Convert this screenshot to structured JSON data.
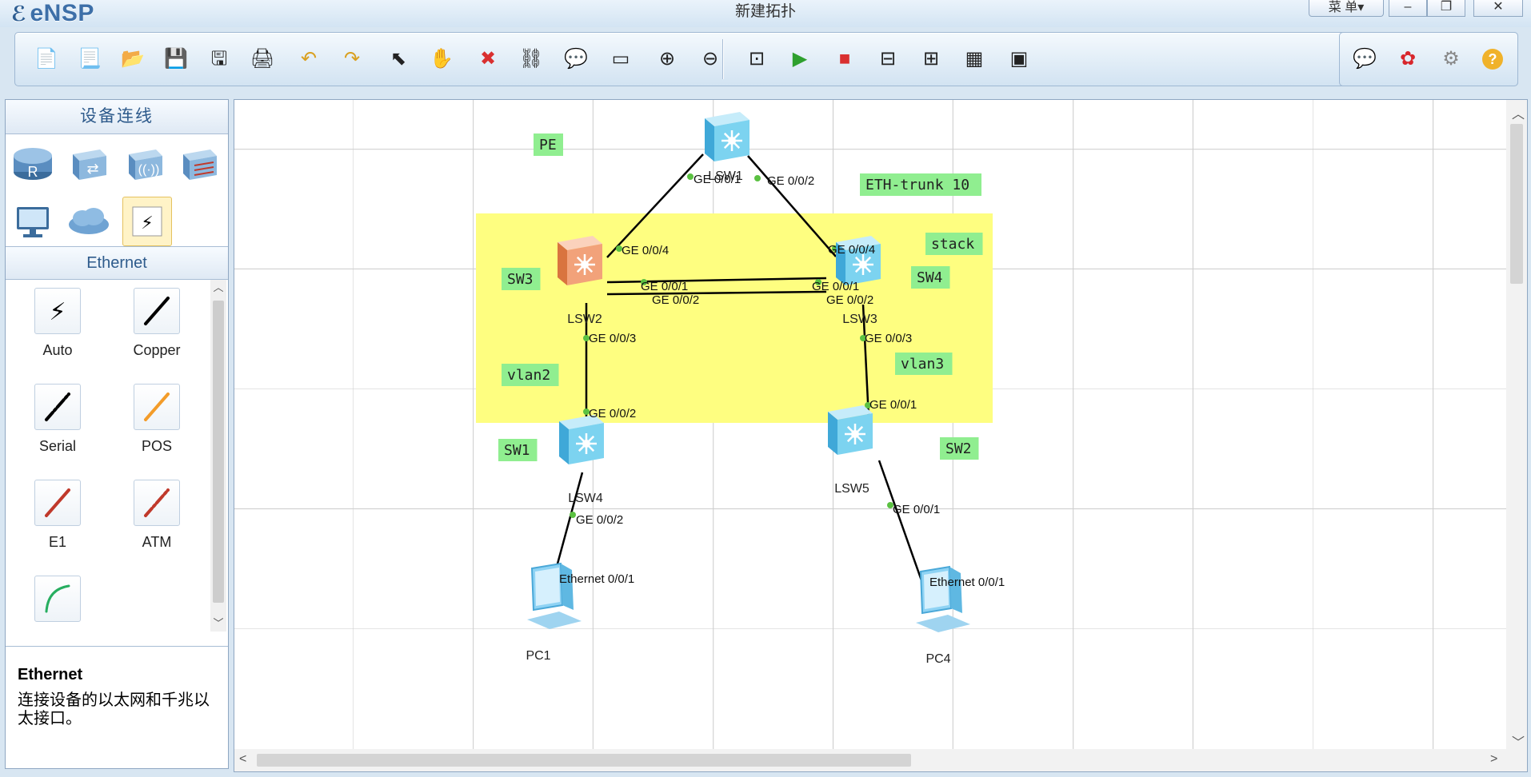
{
  "app": {
    "name": "eNSP",
    "window_title": "新建拓扑",
    "menu_label": "菜 单▾"
  },
  "toolbar": {
    "buttons": [
      {
        "name": "new-topology",
        "icon": "📄"
      },
      {
        "name": "new-example",
        "icon": "📃"
      },
      {
        "name": "open",
        "icon": "📂"
      },
      {
        "name": "save",
        "icon": "💾"
      },
      {
        "name": "save-as",
        "icon": "🖫"
      },
      {
        "name": "print",
        "icon": "🖨"
      },
      {
        "name": "undo",
        "icon": "↶"
      },
      {
        "name": "redo",
        "icon": "↷"
      },
      {
        "name": "select",
        "icon": "⬉"
      },
      {
        "name": "pan",
        "icon": "✋"
      },
      {
        "name": "delete",
        "icon": "✖"
      },
      {
        "name": "delete-links",
        "icon": "⛓"
      },
      {
        "name": "text",
        "icon": "💬"
      },
      {
        "name": "palette",
        "icon": "▭"
      },
      {
        "name": "zoom-in",
        "icon": "⊕"
      },
      {
        "name": "zoom-out",
        "icon": "⊖"
      },
      {
        "name": "fit",
        "icon": "⊡"
      },
      {
        "name": "start",
        "icon": "▶"
      },
      {
        "name": "stop",
        "icon": "■"
      },
      {
        "name": "capture",
        "icon": "⊟"
      },
      {
        "name": "topology",
        "icon": "⊞"
      },
      {
        "name": "grid",
        "icon": "▦"
      },
      {
        "name": "screenshot",
        "icon": "▣"
      }
    ],
    "right_buttons": [
      {
        "name": "chat",
        "icon": "💬"
      },
      {
        "name": "huawei",
        "icon": "✿"
      },
      {
        "name": "settings",
        "icon": "⚙"
      },
      {
        "name": "help",
        "icon": "?"
      }
    ]
  },
  "left_panel": {
    "device_header": "设备连线",
    "device_types": [
      {
        "name": "router",
        "label": "R"
      },
      {
        "name": "switch",
        "label": ""
      },
      {
        "name": "wireless",
        "label": ""
      },
      {
        "name": "firewall",
        "label": ""
      },
      {
        "name": "terminal",
        "label": ""
      },
      {
        "name": "cloud",
        "label": ""
      },
      {
        "name": "cable",
        "label": ""
      }
    ],
    "cable_header": "Ethernet",
    "cables": [
      {
        "label": "Auto",
        "color": "#000000"
      },
      {
        "label": "Copper",
        "color": "#000000"
      },
      {
        "label": "Serial",
        "color": "#000000"
      },
      {
        "label": "POS",
        "color": "#f39c2a"
      },
      {
        "label": "E1",
        "color": "#c0392b"
      },
      {
        "label": "ATM",
        "color": "#c0392b"
      },
      {
        "label": "",
        "color": "#27ae60"
      }
    ],
    "info_title": "Ethernet",
    "info_desc": "连接设备的以太网和千兆以太接口。"
  },
  "topology": {
    "area": {
      "label": "stack",
      "color": "#fefe80"
    },
    "devices": [
      {
        "id": "LSW1",
        "label": "LSW1",
        "kind": "switch",
        "color": "#7cd3f0"
      },
      {
        "id": "LSW2",
        "label": "LSW2",
        "kind": "switch",
        "color": "#f2a27a"
      },
      {
        "id": "LSW3",
        "label": "LSW3",
        "kind": "switch",
        "color": "#7cd3f0"
      },
      {
        "id": "LSW4",
        "label": "LSW4",
        "kind": "switch",
        "color": "#7cd3f0"
      },
      {
        "id": "LSW5",
        "label": "LSW5",
        "kind": "switch",
        "color": "#7cd3f0"
      },
      {
        "id": "PC1",
        "label": "PC1",
        "kind": "pc",
        "color": "#8fd3f4"
      },
      {
        "id": "PC4",
        "label": "PC4",
        "kind": "pc",
        "color": "#8fd3f4"
      }
    ],
    "notes": [
      "PE",
      "ETH-trunk 10",
      "stack",
      "SW3",
      "SW4",
      "vlan2",
      "vlan3",
      "SW1",
      "SW2"
    ],
    "port_labels": [
      "GE 0/0/1",
      "GE 0/0/2",
      "GE 0/0/4",
      "GE 0/0/1",
      "GE 0/0/2",
      "GE 0/0/3",
      "GE 0/0/4",
      "GE 0/0/1",
      "GE 0/0/2",
      "GE 0/0/3",
      "GE 0/0/2",
      "GE 0/0/1",
      "GE 0/0/2",
      "GE 0/0/1",
      "Ethernet 0/0/1",
      "Ethernet 0/0/1"
    ]
  }
}
